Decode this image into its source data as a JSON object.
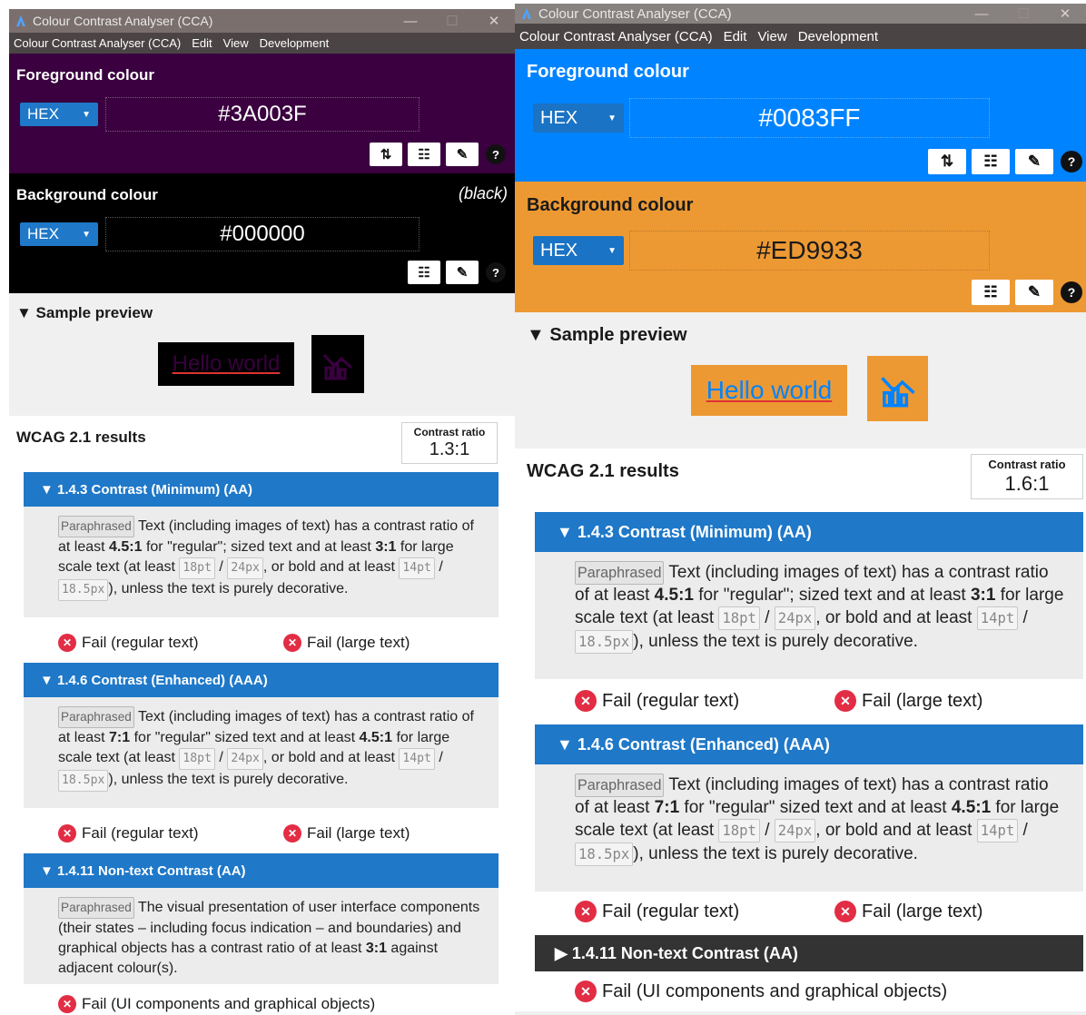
{
  "app_title": "Colour Contrast Analyser (CCA)",
  "window_controls": {
    "minimize": "—",
    "maximize": "☐",
    "close": "✕"
  },
  "menu": [
    "Colour Contrast Analyser (CCA)",
    "Edit",
    "View",
    "Development"
  ],
  "labels": {
    "foreground": "Foreground colour",
    "background": "Background colour",
    "format": "HEX",
    "sample_preview": "▼ Sample preview",
    "hello": "Hello world",
    "wcag": "WCAG 2.1 results",
    "contrast_ratio": "Contrast ratio",
    "paraphrased": "Paraphrased",
    "fail_regular": "Fail (regular text)",
    "fail_large": "Fail (large text)",
    "fail_ui": "Fail (UI components and graphical objects)",
    "sep": "/"
  },
  "criteria": {
    "c143": "▼ 1.4.3 Contrast (Minimum) (AA)",
    "c146": "▼ 1.4.6 Contrast (Enhanced) (AAA)",
    "c1411_open": "▼ 1.4.11 Non-text Contrast (AA)",
    "c1411_closed": "▶ 1.4.11 Non-text Contrast (AA)"
  },
  "desc": {
    "c143": {
      "t1": " Text (including images of text) has a contrast ratio of at least ",
      "b1": "4.5:1",
      "t2": " for \"regular\"; sized text and at least ",
      "b2": "3:1",
      "t3": " for large scale text (at least ",
      "t4": ", or bold and at least ",
      "t5": "), unless the text is purely decorative."
    },
    "c146": {
      "t1": " Text (including images of text) has a contrast ratio of at least ",
      "b1": "7:1",
      "t2": " for \"regular\" sized text and at least ",
      "b2": "4.5:1",
      "t3": " for large scale text (at least ",
      "t4": ", or bold and at least ",
      "t5": "), unless the text is purely decorative."
    },
    "c1411": {
      "t1": " The visual presentation of user interface components (their states – including focus indication – and boundaries) and graphical objects has a contrast ratio of at least ",
      "b1": "3:1",
      "t2": " against adjacent colour(s)."
    },
    "sizes": {
      "pt18": "18pt",
      "px24": "24px",
      "pt14": "14pt",
      "px185": "18.5px"
    }
  },
  "left": {
    "fg_hex": "#3A003F",
    "bg_hex": "#000000",
    "bg_name": "(black)",
    "ratio": "1.3:1",
    "colors": {
      "fg": "#3A003F",
      "bg": "#000000"
    }
  },
  "right": {
    "fg_hex": "#0083FF",
    "bg_hex": "#ED9933",
    "ratio": "1.6:1",
    "colors": {
      "fg": "#0083FF",
      "bg": "#ED9933"
    }
  },
  "icons": [
    "app-icon",
    "swap-icon",
    "sliders-icon",
    "eyedropper-icon",
    "help-icon",
    "chart-icon",
    "fail-icon"
  ]
}
